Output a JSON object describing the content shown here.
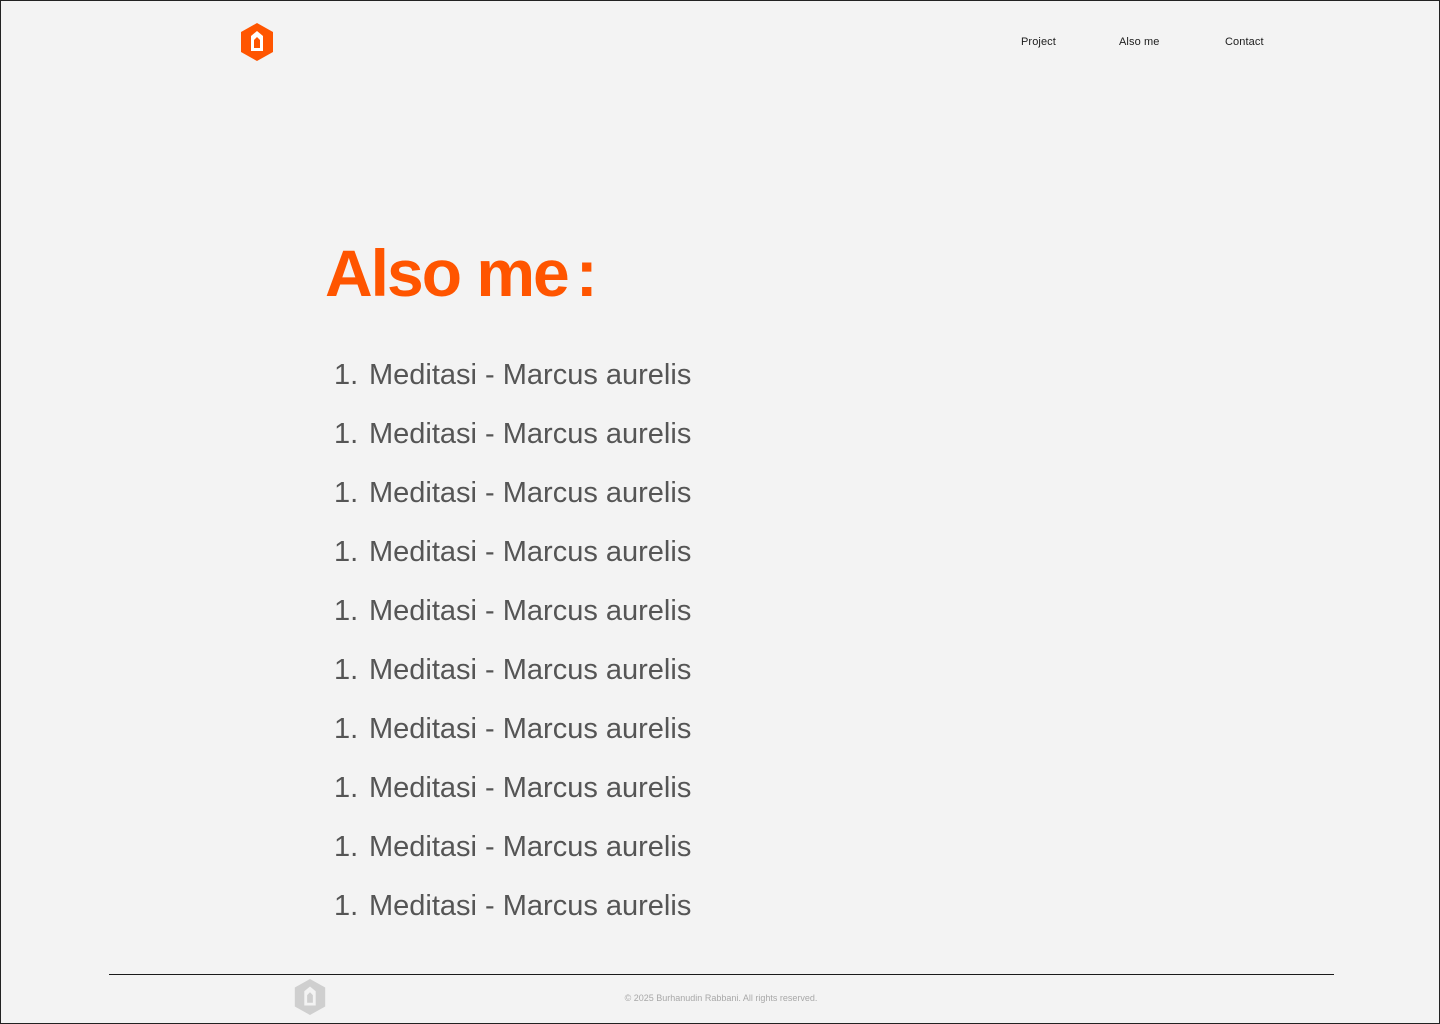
{
  "header": {
    "logo": "hexagon-logo-icon",
    "nav": [
      {
        "label": "Project"
      },
      {
        "label": "Also me"
      },
      {
        "label": "Contact"
      }
    ]
  },
  "main": {
    "title": "Also me",
    "title_suffix": ":",
    "items": [
      {
        "number": "1.",
        "text": "Meditasi - Marcus aurelis"
      },
      {
        "number": "1.",
        "text": "Meditasi - Marcus aurelis"
      },
      {
        "number": "1.",
        "text": "Meditasi - Marcus aurelis"
      },
      {
        "number": "1.",
        "text": "Meditasi - Marcus aurelis"
      },
      {
        "number": "1.",
        "text": "Meditasi - Marcus aurelis"
      },
      {
        "number": "1.",
        "text": "Meditasi - Marcus aurelis"
      },
      {
        "number": "1.",
        "text": "Meditasi - Marcus aurelis"
      },
      {
        "number": "1.",
        "text": "Meditasi - Marcus aurelis"
      },
      {
        "number": "1.",
        "text": "Meditasi - Marcus aurelis"
      },
      {
        "number": "1.",
        "text": "Meditasi - Marcus aurelis"
      }
    ]
  },
  "footer": {
    "logo": "hexagon-logo-icon",
    "copyright": "© 2025 Burhanudin Rabbani. All rights reserved."
  },
  "colors": {
    "accent": "#ff5500",
    "background": "#f3f3f3",
    "list_text": "#555555",
    "footer_logo": "#cfcfcf"
  }
}
